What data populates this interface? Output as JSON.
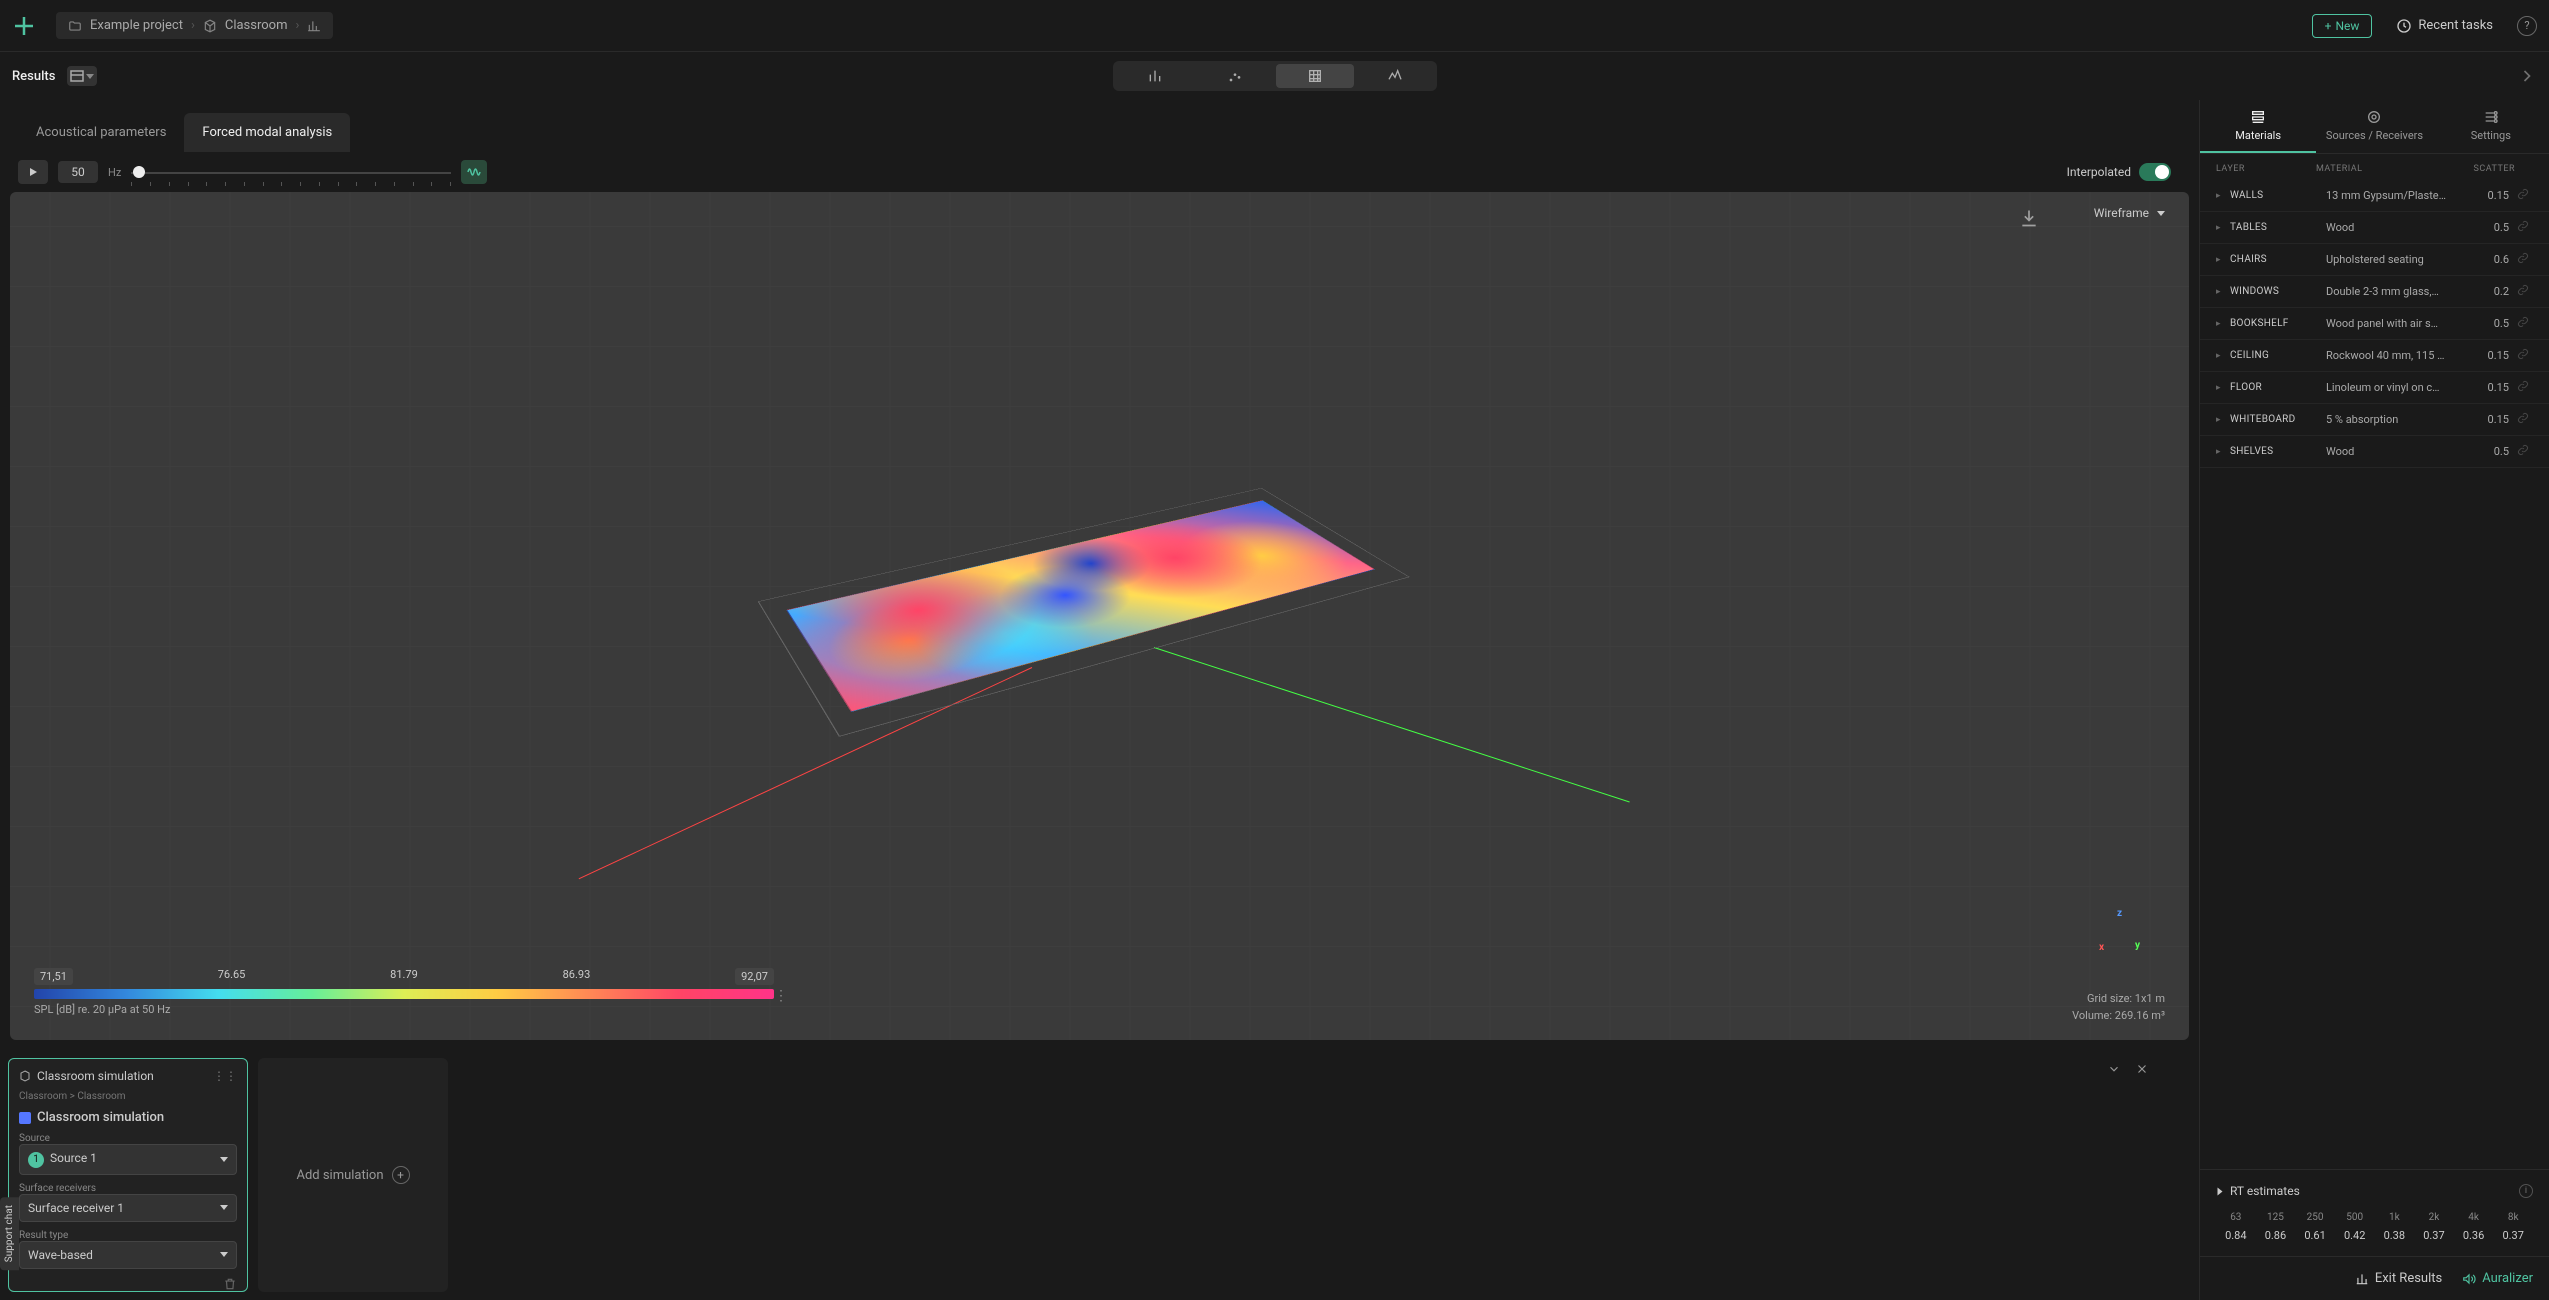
{
  "header": {
    "breadcrumb": {
      "project": "Example project",
      "model": "Classroom"
    },
    "new_button": "New",
    "recent_tasks": "Recent tasks"
  },
  "toolbar": {
    "results_label": "Results"
  },
  "sub_tabs": {
    "acoustical": "Acoustical parameters",
    "modal": "Forced modal analysis"
  },
  "controls": {
    "frequency_value": "50",
    "hz": "Hz",
    "interpolated_label": "Interpolated"
  },
  "viewport": {
    "wireframe_label": "Wireframe",
    "grid_size": "Grid size: 1x1 m",
    "volume": "Volume: 269.16 m³",
    "legend": {
      "min": "71,51",
      "v2": "76.65",
      "v3": "81.79",
      "v4": "86.93",
      "max": "92,07",
      "label": "SPL [dB] re. 20 μPa at 50 Hz"
    },
    "gizmo": {
      "x": "x",
      "y": "y",
      "z": "z"
    }
  },
  "sim_card": {
    "title": "Classroom simulation",
    "path": "Classroom > Classroom",
    "sim_name": "Classroom simulation",
    "labels": {
      "source": "Source",
      "surface_receivers": "Surface receivers",
      "result_type": "Result type"
    },
    "values": {
      "source": "Source 1",
      "source_badge": "1",
      "surface_receiver": "Surface receiver 1",
      "result_type": "Wave-based"
    }
  },
  "add_simulation": "Add simulation",
  "sidebar": {
    "tabs": {
      "materials": "Materials",
      "sources": "Sources / Receivers",
      "settings": "Settings"
    },
    "headers": {
      "layer": "LAYER",
      "material": "MATERIAL",
      "scatter": "SCATTER"
    },
    "materials": [
      {
        "layer": "WALLS",
        "material": "13 mm Gypsum/Plaste…",
        "scatter": "0.15"
      },
      {
        "layer": "TABLES",
        "material": "Wood",
        "scatter": "0.5"
      },
      {
        "layer": "CHAIRS",
        "material": "Upholstered seating",
        "scatter": "0.6"
      },
      {
        "layer": "WINDOWS",
        "material": "Double 2-3 mm glass,…",
        "scatter": "0.2"
      },
      {
        "layer": "BOOKSHELF",
        "material": "Wood panel with air s…",
        "scatter": "0.5"
      },
      {
        "layer": "CEILING",
        "material": "Rockwool 40 mm, 115 …",
        "scatter": "0.15"
      },
      {
        "layer": "FLOOR",
        "material": "Linoleum or vinyl on c…",
        "scatter": "0.15"
      },
      {
        "layer": "WHITEBOARD",
        "material": "5 % absorption",
        "scatter": "0.15"
      },
      {
        "layer": "SHELVES",
        "material": "Wood",
        "scatter": "0.5"
      }
    ],
    "rt": {
      "title": "RT estimates",
      "freqs": [
        "63",
        "125",
        "250",
        "500",
        "1k",
        "2k",
        "4k",
        "8k"
      ],
      "values": [
        "0.84",
        "0.86",
        "0.61",
        "0.42",
        "0.38",
        "0.37",
        "0.36",
        "0.37"
      ]
    },
    "actions": {
      "exit": "Exit Results",
      "auralizer": "Auralizer"
    }
  },
  "support_tab": "Support chat"
}
